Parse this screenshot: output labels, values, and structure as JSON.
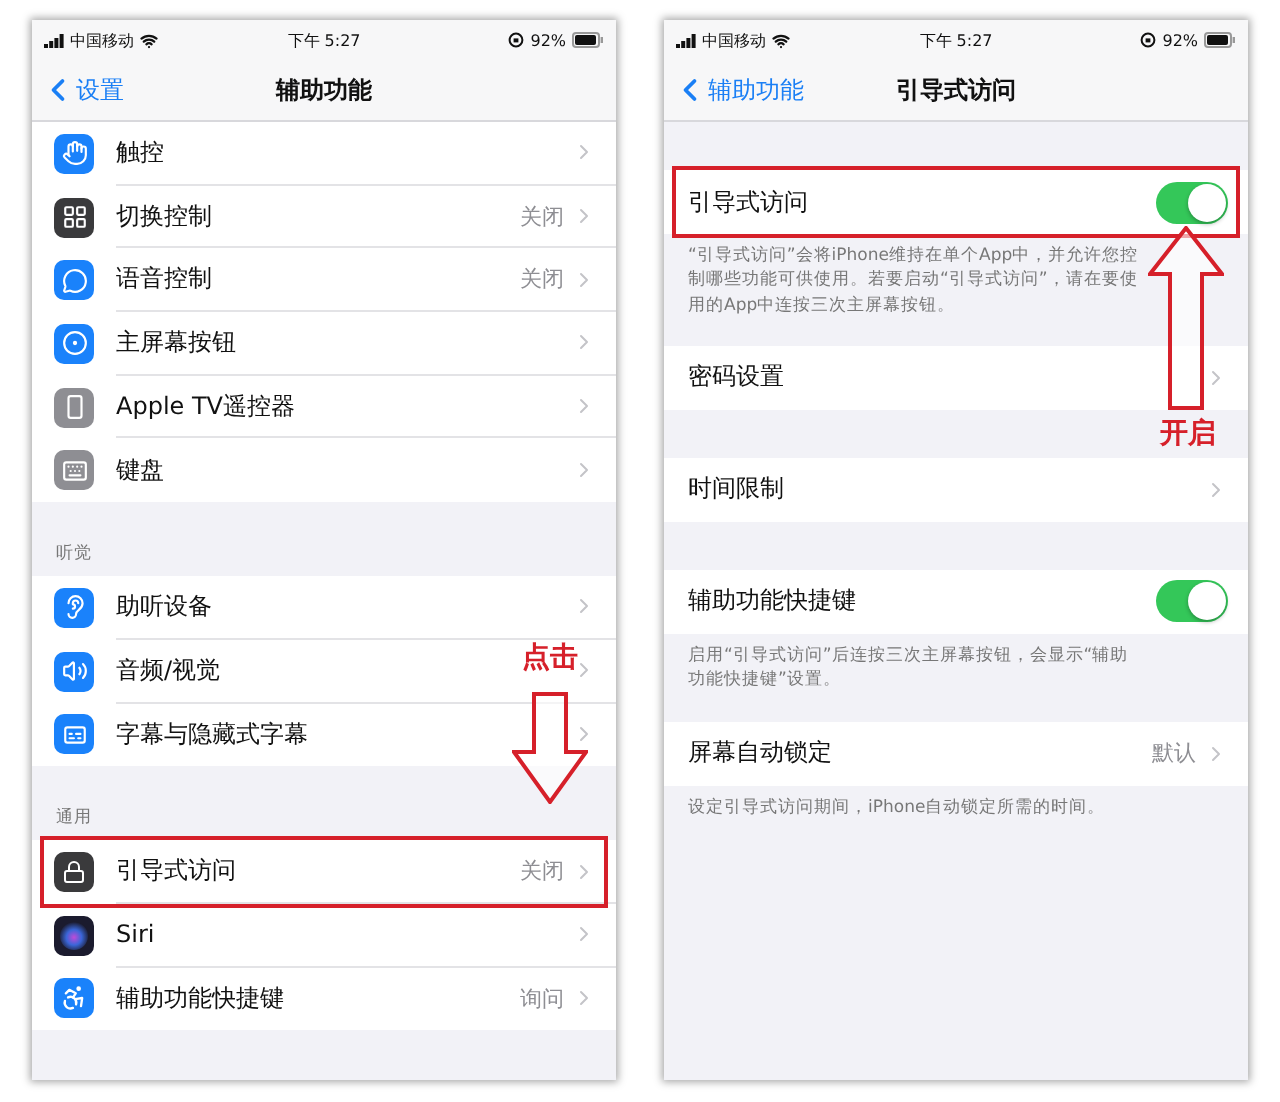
{
  "screens": [
    {
      "status_bar": {
        "carrier": "中国移动",
        "time": "下午 5:27",
        "battery": "92%"
      },
      "nav_bar": {
        "back": "设置",
        "title": "辅助功能"
      },
      "groups": [
        {
          "rows": [
            {
              "kind": "link",
              "label": "触控",
              "highlighted": false
            },
            {
              "kind": "link",
              "label": "切换控制",
              "value": "关闭",
              "highlighted": false
            },
            {
              "kind": "link",
              "label": "语音控制",
              "value": "关闭",
              "highlighted": false
            },
            {
              "kind": "link",
              "label": "主屏幕按钮",
              "highlighted": false
            },
            {
              "kind": "link",
              "label": "Apple TV遥控器",
              "highlighted": false
            },
            {
              "kind": "link",
              "label": "键盘",
              "highlighted": false
            }
          ]
        },
        {
          "header": "听觉",
          "rows": [
            {
              "kind": "link",
              "label": "助听设备",
              "highlighted": false
            },
            {
              "kind": "link",
              "label": "音频/视觉",
              "highlighted": false
            },
            {
              "kind": "link",
              "label": "字幕与隐藏式字幕",
              "highlighted": false
            }
          ]
        },
        {
          "header": "通用",
          "rows": [
            {
              "kind": "link",
              "label": "引导式访问",
              "value": "关闭",
              "highlighted": true
            },
            {
              "kind": "link",
              "label": "Siri",
              "highlighted": false
            },
            {
              "kind": "link",
              "label": "辅助功能快捷键",
              "value": "询问",
              "highlighted": false
            }
          ]
        }
      ],
      "annotation": {
        "text": "点击"
      }
    },
    {
      "status_bar": {
        "carrier": "中国移动",
        "time": "下午 5:27",
        "battery": "92%"
      },
      "nav_bar": {
        "back": "辅助功能",
        "title": "引导式访问"
      },
      "groups": [
        {
          "rows": [
            {
              "kind": "toggle",
              "label": "引导式访问",
              "on": true,
              "highlighted": true
            }
          ],
          "footer": "“引导式访问”会将iPhone维持在单个App中，并允许您控制哪些功能可供使用。若要启动“引导式访问”，请在要使用的App中连按三次主屏幕按钮。"
        },
        {
          "rows": [
            {
              "kind": "link",
              "label": "密码设置",
              "highlighted": false
            }
          ]
        },
        {
          "rows": [
            {
              "kind": "link",
              "label": "时间限制",
              "highlighted": false
            }
          ]
        },
        {
          "rows": [
            {
              "kind": "toggle",
              "label": "辅助功能快捷键",
              "on": true,
              "highlighted": false
            }
          ],
          "footer": "启用“引导式访问”后连按三次主屏幕按钮，会显示“辅助功能快捷键”设置。"
        },
        {
          "rows": [
            {
              "kind": "link",
              "label": "屏幕自动锁定",
              "value": "默认",
              "highlighted": false
            }
          ],
          "footer": "设定引导式访问期间，iPhone自动锁定所需的时间。"
        }
      ],
      "annotation": {
        "text": "开启"
      }
    }
  ]
}
